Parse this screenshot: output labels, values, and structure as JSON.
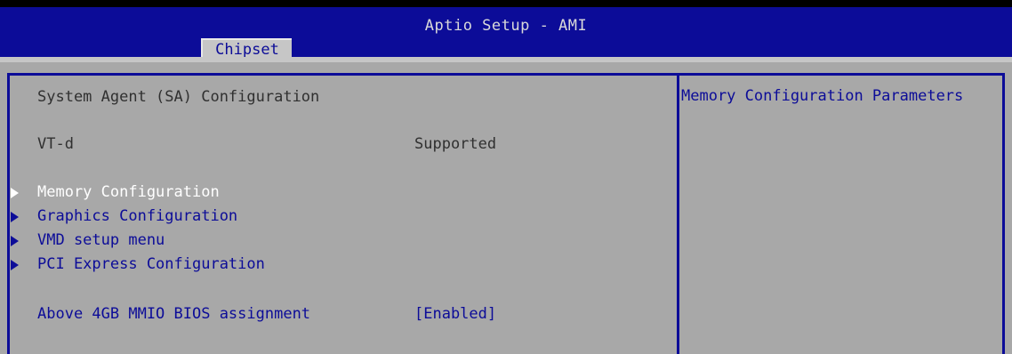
{
  "header": {
    "title": "Aptio Setup - AMI",
    "active_tab": "Chipset"
  },
  "left_panel": {
    "section_title": "System Agent (SA) Configuration",
    "vtd": {
      "label": "VT-d",
      "value": "Supported"
    },
    "submenus": [
      {
        "label": "Memory Configuration",
        "selected": true
      },
      {
        "label": "Graphics Configuration",
        "selected": false
      },
      {
        "label": "VMD setup menu",
        "selected": false
      },
      {
        "label": "PCI Express Configuration",
        "selected": false
      }
    ],
    "option": {
      "label": "Above 4GB MMIO BIOS assignment",
      "value": "[Enabled]"
    }
  },
  "help_panel": {
    "text": "Memory Configuration Parameters"
  },
  "colors": {
    "header_blue": "#0c0c98",
    "panel_gray": "#a8a8a8",
    "tab_gray": "#c6c6c6",
    "selected_text": "#ffffff",
    "link_text": "#0c0c98",
    "static_text": "#303030"
  },
  "icons": {
    "submenu_arrow": "triangle-right-icon"
  }
}
